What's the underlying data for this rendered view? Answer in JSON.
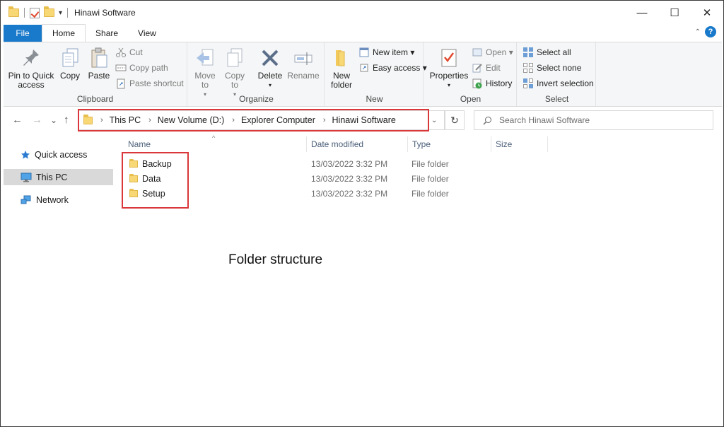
{
  "window": {
    "title": "Hinawi Software",
    "qat_dropdown": "▾",
    "minimize": "—",
    "maximize": "☐",
    "close": "✕"
  },
  "tabs": [
    {
      "label": "File"
    },
    {
      "label": "Home"
    },
    {
      "label": "Share"
    },
    {
      "label": "View"
    }
  ],
  "help": {
    "chevron": "⌃",
    "label": "?"
  },
  "ribbon": {
    "clipboard": {
      "label": "Clipboard",
      "pin": "Pin to Quick access",
      "copy": "Copy",
      "paste": "Paste",
      "cut": "Cut",
      "copy_path": "Copy path",
      "paste_shortcut": "Paste shortcut"
    },
    "organize": {
      "label": "Organize",
      "move_to": "Move to",
      "copy_to": "Copy to",
      "delete": "Delete",
      "rename": "Rename"
    },
    "new": {
      "label": "New",
      "new_folder": "New folder",
      "new_item": "New item ▾",
      "easy_access": "Easy access ▾"
    },
    "open": {
      "label": "Open",
      "properties": "Properties",
      "open": "Open ▾",
      "edit": "Edit",
      "history": "History"
    },
    "select": {
      "label": "Select",
      "select_all": "Select all",
      "select_none": "Select none",
      "invert_selection": "Invert selection"
    }
  },
  "nav": {
    "back": "←",
    "forward": "→",
    "recent": "⌄",
    "up": "↑",
    "breadcrumb": [
      "This PC",
      "New Volume (D:)",
      "Explorer Computer",
      "Hinawi Software"
    ],
    "separator": "›",
    "refresh": "↻",
    "search_placeholder": "Search Hinawi Software"
  },
  "sidebar": {
    "items": [
      {
        "label": "Quick access"
      },
      {
        "label": "This PC"
      },
      {
        "label": "Network"
      }
    ]
  },
  "columns": [
    "Name",
    "Date modified",
    "Type",
    "Size"
  ],
  "files": [
    {
      "name": "Backup",
      "date": "13/03/2022 3:32 PM",
      "type": "File folder"
    },
    {
      "name": "Data",
      "date": "13/03/2022 3:32 PM",
      "type": "File folder"
    },
    {
      "name": "Setup",
      "date": "13/03/2022 3:32 PM",
      "type": "File folder"
    }
  ],
  "caption": "Folder structure",
  "colors": {
    "accent": "#1979ca",
    "highlight": "#d9373a",
    "folder": "#f8d775"
  }
}
